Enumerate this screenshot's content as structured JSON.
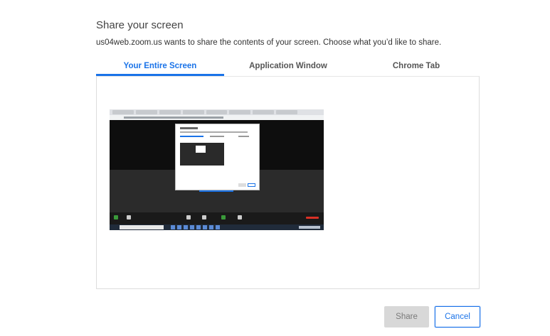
{
  "dialog": {
    "title": "Share your screen",
    "subtitle": "us04web.zoom.us wants to share the contents of your screen. Choose what you’d like to share."
  },
  "tabs": [
    {
      "label": "Your Entire Screen",
      "active": true
    },
    {
      "label": "Application Window",
      "active": false
    },
    {
      "label": "Chrome Tab",
      "active": false
    }
  ],
  "preview": {
    "icon": "screen-thumbnail"
  },
  "buttons": {
    "share_label": "Share",
    "cancel_label": "Cancel"
  },
  "colors": {
    "accent": "#1a73e8",
    "disabled_bg": "#d8d8d8"
  }
}
